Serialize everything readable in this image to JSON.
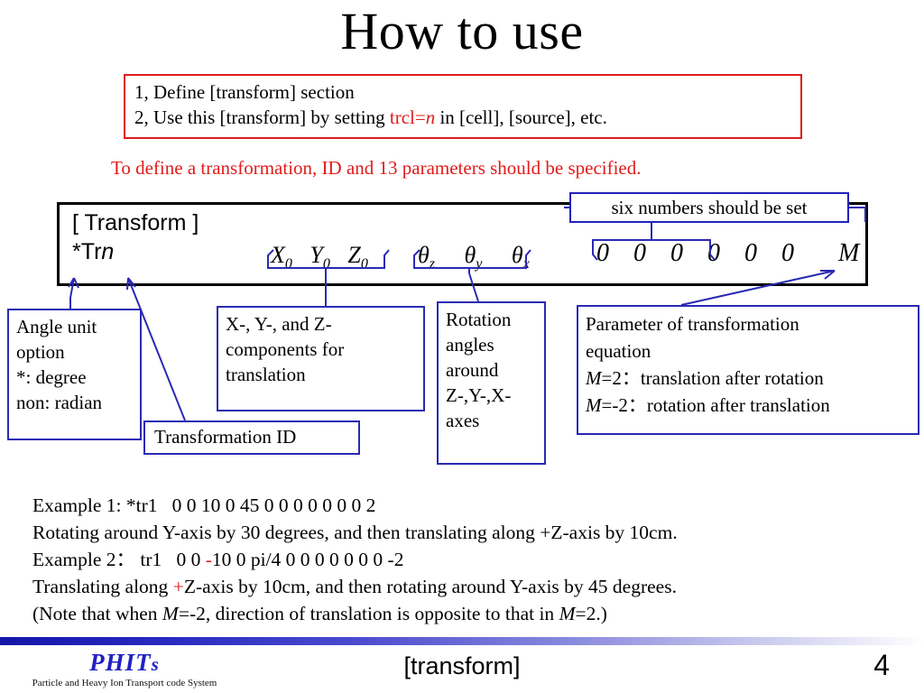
{
  "slide": {
    "title": "How to use",
    "page_number": "4",
    "footer_center": "[transform]"
  },
  "steps_box": {
    "line1": "1, Define [transform] section",
    "line2_prefix": "2, Use this [transform] by setting ",
    "line2_code_red": "trcl=",
    "line2_code_italic": "n",
    "line2_suffix": " in [cell], [source], etc.",
    "border_color": "#e01b1b"
  },
  "red_note": {
    "text": "To define a transformation, ID and 13 parameters should be specified.",
    "color": "#e01b1b"
  },
  "syntax": {
    "section_name": "[ Transform ]",
    "card_prefix": "*Tr",
    "card_var": "n",
    "translation": [
      "X",
      "Y",
      "Z"
    ],
    "translation_sub": "0",
    "angles": [
      "z",
      "y",
      "x"
    ],
    "angle_symbol": "θ",
    "zeros": "0 0 0 0 0 0",
    "m_param": "M",
    "box_border_color": "#000000"
  },
  "callouts": {
    "six_numbers": "six numbers should be set",
    "angle_unit": [
      "Angle unit",
      "option",
      "*: degree",
      "non: radian"
    ],
    "xyz_components": [
      "X-, Y-, and Z-",
      "components for",
      "translation"
    ],
    "rotation_angles": [
      "Rotation",
      "angles",
      "around",
      "Z-,Y-,X-",
      "axes"
    ],
    "transformation_id": "Transformation ID",
    "parameter_eq": {
      "line1": "Parameter of transformation",
      "line2": "equation",
      "line3_var": "M",
      "line3_rest": "=2：translation after rotation",
      "line4_var": "M",
      "line4_rest": "=-2：rotation after translation"
    },
    "border_color": "#2a2ab4"
  },
  "examples": {
    "ex1_label": "Example 1: *tr1",
    "ex1_values": "0 0 10    0 45 0    0 0 0 0 0 0    2",
    "ex1_desc": "Rotating around Y-axis by 30 degrees, and then translating along +Z-axis by 10cm.",
    "ex2_label": "Example 2：  tr1",
    "ex2_val_a": "0 0 ",
    "ex2_val_minus": "-",
    "ex2_val_b": "10    0 pi/4 0    0 0 0 0 0 0    -2",
    "ex2_desc_a": "Translating along ",
    "ex2_desc_plus": "+",
    "ex2_desc_b": "Z-axis by 10cm, and then rotating around Y-axis by 45 degrees.",
    "note_a": "(Note that when ",
    "note_m1": "M",
    "note_b": "=-2, direction of translation is opposite to that in ",
    "note_m2": "M",
    "note_c": "=2.)"
  },
  "logo": {
    "name_main": "PHIT",
    "name_tail": "s",
    "tagline": "Particle and Heavy Ion Transport code System",
    "color": "#2121c4"
  }
}
